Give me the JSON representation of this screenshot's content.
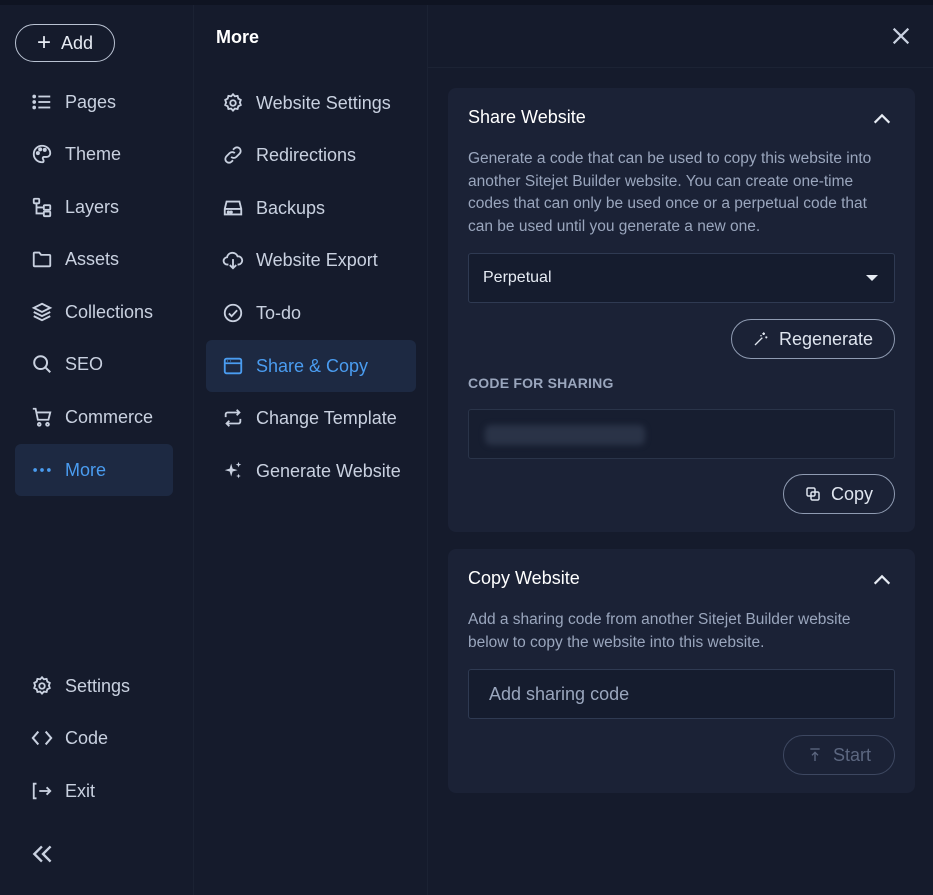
{
  "rail": {
    "add_label": "Add",
    "items": [
      {
        "label": "Pages",
        "icon": "list-icon"
      },
      {
        "label": "Theme",
        "icon": "palette-icon"
      },
      {
        "label": "Layers",
        "icon": "layers-tree-icon"
      },
      {
        "label": "Assets",
        "icon": "folder-icon"
      },
      {
        "label": "Collections",
        "icon": "stack-icon"
      },
      {
        "label": "SEO",
        "icon": "search-icon"
      },
      {
        "label": "Commerce",
        "icon": "cart-icon"
      },
      {
        "label": "More",
        "icon": "more-dots-icon",
        "active": true
      }
    ],
    "bottom_items": [
      {
        "label": "Settings",
        "icon": "gear-icon"
      },
      {
        "label": "Code",
        "icon": "code-icon"
      },
      {
        "label": "Exit",
        "icon": "exit-icon"
      }
    ]
  },
  "mid": {
    "title": "More",
    "items": [
      {
        "label": "Website Settings",
        "icon": "gear-icon"
      },
      {
        "label": "Redirections",
        "icon": "link-icon"
      },
      {
        "label": "Backups",
        "icon": "drive-icon"
      },
      {
        "label": "Website Export",
        "icon": "cloud-download-icon"
      },
      {
        "label": "To-do",
        "icon": "check-circle-icon"
      },
      {
        "label": "Share & Copy",
        "icon": "browser-window-icon",
        "active": true
      },
      {
        "label": "Change Template",
        "icon": "swap-icon"
      },
      {
        "label": "Generate Website",
        "icon": "sparkles-icon"
      }
    ]
  },
  "share": {
    "title": "Share Website",
    "description": "Generate a code that can be used to copy this website into another Sitejet Builder website. You can create one-time codes that can only be used once or a perpetual code that can be used until you generate a new one.",
    "mode_value": "Perpetual",
    "regenerate_label": "Regenerate",
    "code_label": "CODE FOR SHARING",
    "copy_label": "Copy"
  },
  "copy": {
    "title": "Copy Website",
    "description": "Add a sharing code from another Sitejet Builder website below to copy the website into this website.",
    "input_placeholder": "Add sharing code",
    "start_label": "Start"
  },
  "colors": {
    "background": "#151b2c",
    "card": "#1b2236",
    "accent": "#4a9cf0",
    "active_bg": "#1d2942"
  }
}
